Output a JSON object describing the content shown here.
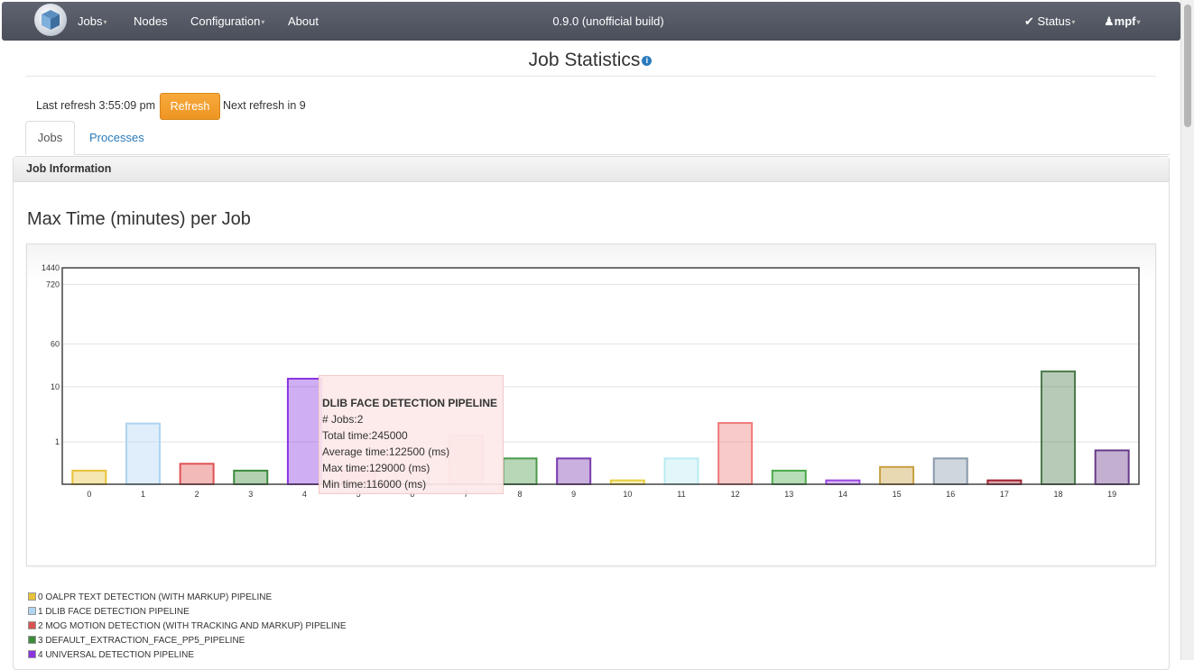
{
  "navbar": {
    "jobs": "Jobs",
    "nodes": "Nodes",
    "configuration": "Configuration",
    "about": "About",
    "version": "0.9.0 (unofficial build)",
    "status": "Status",
    "user": "mpf"
  },
  "page": {
    "title": "Job Statistics",
    "last_refresh": "Last refresh 3:55:09 pm",
    "refresh_button": "Refresh",
    "next_refresh": "Next refresh in 9",
    "tabs": [
      "Jobs",
      "Processes"
    ],
    "panel_heading": "Job Information",
    "chart_title": "Max Time (minutes) per Job"
  },
  "tooltip": {
    "title": "DLIB FACE DETECTION PIPELINE",
    "jobs": "# Jobs:2",
    "total": "Total time:245000",
    "average": "Average time:122500 (ms)",
    "max": "Max time:129000 (ms)",
    "min": "Min time:116000 (ms)"
  },
  "legend": [
    {
      "label": "0 OALPR TEXT DETECTION (WITH MARKUP) PIPELINE",
      "color": "#e8c23a"
    },
    {
      "label": "1 DLIB FACE DETECTION PIPELINE",
      "color": "#aed4f2"
    },
    {
      "label": "2 MOG MOTION DETECTION (WITH TRACKING AND MARKUP) PIPELINE",
      "color": "#d9534f"
    },
    {
      "label": "3 DEFAULT_EXTRACTION_FACE_PP5_PIPELINE",
      "color": "#3c8c3c"
    },
    {
      "label": "4 UNIVERSAL DETECTION PIPELINE",
      "color": "#8a35e0"
    }
  ],
  "chart_data": {
    "type": "bar",
    "scale": "log",
    "categories": [
      "0",
      "1",
      "2",
      "3",
      "4",
      "5",
      "6",
      "7",
      "8",
      "9",
      "10",
      "11",
      "12",
      "13",
      "14",
      "15",
      "16",
      "17",
      "18",
      "19"
    ],
    "values": [
      0.3,
      2.15,
      0.4,
      0.3,
      14,
      0.3,
      0.3,
      1.3,
      0.5,
      0.5,
      0.2,
      0.5,
      2.2,
      0.3,
      0.2,
      0.35,
      0.5,
      0.2,
      19,
      0.7
    ],
    "colors": [
      "#e8c23a",
      "#aed4f2",
      "#e05252",
      "#3c8c3c",
      "#8a35e0",
      "#f0a0a0",
      "#cccccc",
      "#e8b0b0",
      "#4a9a4a",
      "#7a3ab0",
      "#e8d040",
      "#b8ecf2",
      "#f07a7a",
      "#4aaa4a",
      "#9a4ae0",
      "#c8a040",
      "#8899aa",
      "#a02030",
      "#4a7a4a",
      "#6a3a8a"
    ],
    "yticks": [
      1,
      10,
      60,
      720,
      1440
    ],
    "ylim": [
      0.17,
      1440
    ],
    "grid": true
  }
}
